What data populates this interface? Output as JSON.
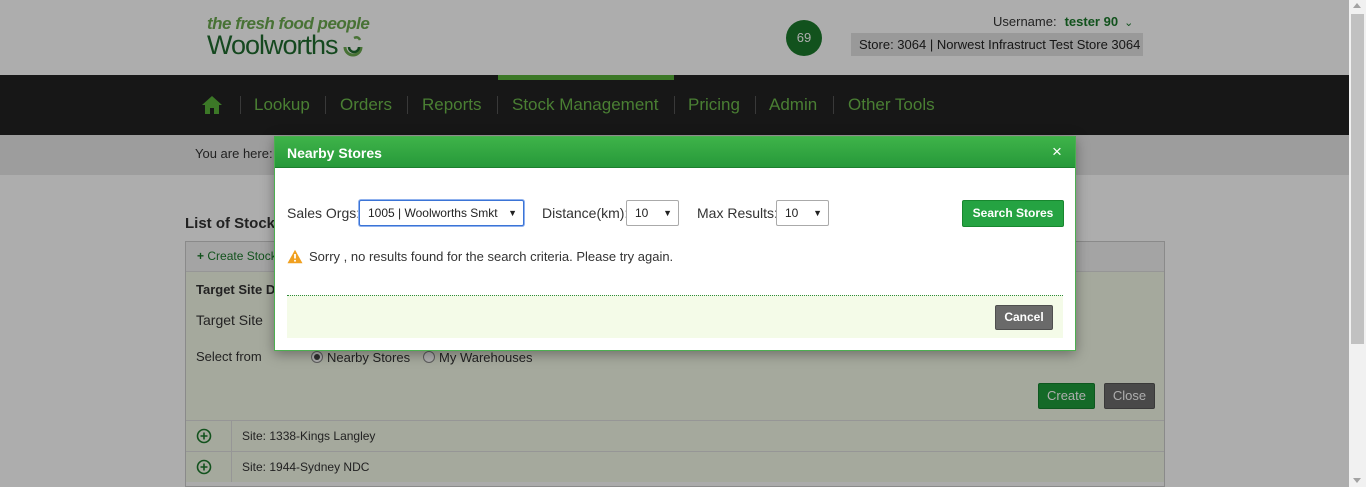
{
  "header": {
    "tagline": "the fresh food people",
    "brand": "Woolworths",
    "notification_count": "69",
    "username_label": "Username:",
    "username": "tester 90",
    "store": "Store: 3064 | Norwest Infrastruct Test Store 3064"
  },
  "nav": {
    "items": [
      {
        "label": "Lookup"
      },
      {
        "label": "Orders"
      },
      {
        "label": "Reports"
      },
      {
        "label": "Stock Management"
      },
      {
        "label": "Pricing"
      },
      {
        "label": "Admin"
      },
      {
        "label": "Other Tools"
      }
    ],
    "active": "Stock Management"
  },
  "breadcrumb": {
    "label": "You are here:"
  },
  "page": {
    "title": "List of Stock",
    "create_link": "Create Stock",
    "target_title": "Target Site D",
    "target_site_label": "Target Site",
    "select_from_label": "Select from",
    "radio_nearby": "Nearby Stores",
    "radio_warehouses": "My Warehouses",
    "selected_source": "Nearby Stores",
    "create_button": "Create",
    "close_button": "Close",
    "sites": [
      {
        "label": "Site: 1338-Kings Langley"
      },
      {
        "label": "Site: 1944-Sydney NDC"
      }
    ]
  },
  "modal": {
    "title": "Nearby Stores",
    "close_glyph": "×",
    "sales_orgs_label": "Sales Orgs:",
    "sales_orgs_value": "1005 | Woolworths Smkt",
    "distance_label": "Distance(km):",
    "distance_value": "10",
    "max_results_label": "Max Results:",
    "max_results_value": "10",
    "search_button": "Search Stores",
    "message": "Sorry , no results found for the search criteria. Please try again.",
    "cancel_button": "Cancel"
  },
  "colors": {
    "brand_green": "#1b7a2b",
    "nav_background": "#222222",
    "nav_text": "#6dbb4c",
    "modal_header": "#2fa640",
    "warning": "#f0a020"
  },
  "icons": {
    "home": "home-icon",
    "chevron": "chevron-down-icon",
    "warning": "warning-icon",
    "expand": "plus-circle-icon",
    "close": "close-icon"
  }
}
